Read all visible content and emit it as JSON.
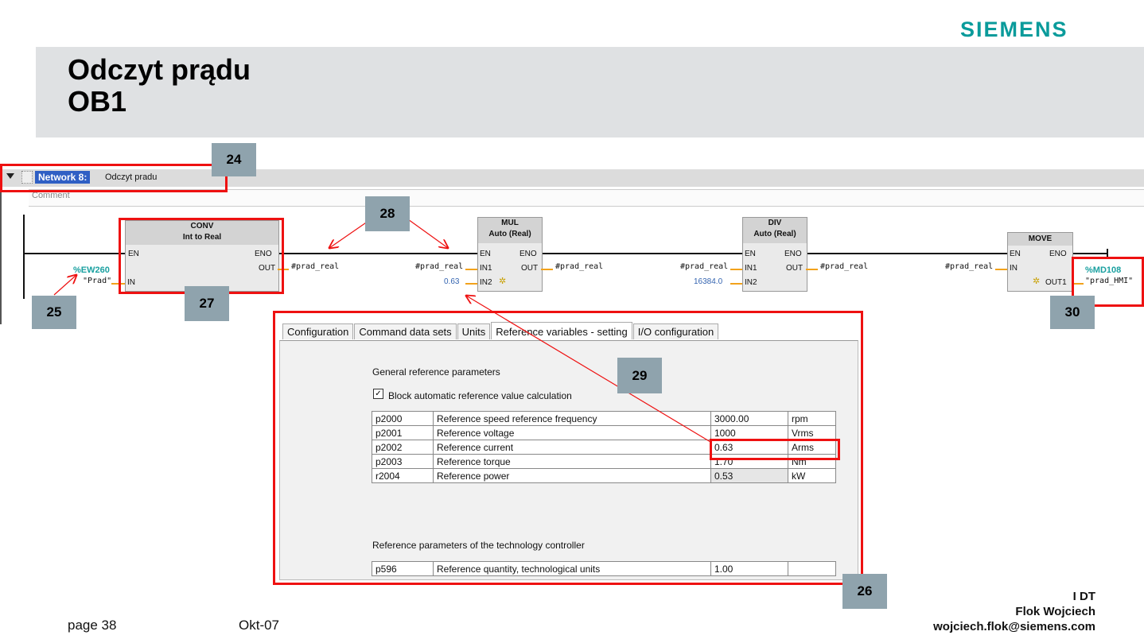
{
  "brand": {
    "logo": "SIEMENS",
    "color": "#0a9b9b"
  },
  "slide": {
    "title_line1": "Odczyt prądu",
    "title_line2": "OB1"
  },
  "network": {
    "label": "Network 8:",
    "title": "Odczyt pradu",
    "comment": "Comment"
  },
  "blocks": {
    "conv": {
      "name": "CONV",
      "type": "Int  to  Real",
      "en": "EN",
      "eno": "ENO",
      "out": "OUT",
      "in": "IN",
      "out_var": "#prad_real"
    },
    "input": {
      "address": "%EW260",
      "symbol": "\"Prad\""
    },
    "mul": {
      "name": "MUL",
      "type": "Auto (Real)",
      "en": "EN",
      "eno": "ENO",
      "in1": "IN1",
      "in2": "IN2",
      "out": "OUT",
      "in1_var": "#prad_real",
      "in2_val": "0.63",
      "out_var": "#prad_real"
    },
    "div": {
      "name": "DIV",
      "type": "Auto (Real)",
      "en": "EN",
      "eno": "ENO",
      "in1": "IN1",
      "in2": "IN2",
      "out": "OUT",
      "in1_var": "#prad_real",
      "in2_val": "16384.0",
      "out_var": "#prad_real"
    },
    "move": {
      "name": "MOVE",
      "en": "EN",
      "eno": "ENO",
      "in": "IN",
      "out1": "OUT1",
      "in_var": "#prad_real",
      "out_address": "%MD108",
      "out_symbol": "\"prad_HMI\""
    }
  },
  "dialog": {
    "tabs": [
      "Configuration",
      "Command data sets",
      "Units",
      "Reference variables - setting",
      "I/O configuration"
    ],
    "active_tab": "Reference variables - setting",
    "general_title": "General reference parameters",
    "checkbox_label": "Block automatic reference value calculation",
    "checkbox_checked": true,
    "params": [
      {
        "id": "p2000",
        "name": "Reference speed reference frequency",
        "value": "3000.00",
        "unit": "rpm"
      },
      {
        "id": "p2001",
        "name": "Reference voltage",
        "value": "1000",
        "unit": "Vrms"
      },
      {
        "id": "p2002",
        "name": "Reference current",
        "value": "0.63",
        "unit": "Arms"
      },
      {
        "id": "p2003",
        "name": "Reference torque",
        "value": "1.70",
        "unit": "Nm"
      },
      {
        "id": "r2004",
        "name": "Reference power",
        "value": "0.53",
        "unit": "kW"
      }
    ],
    "tech_title": "Reference parameters of the technology controller",
    "tech_params": [
      {
        "id": "p596",
        "name": "Reference quantity, technological units",
        "value": "1.00",
        "unit": ""
      }
    ]
  },
  "callouts": {
    "c24": "24",
    "c25": "25",
    "c26": "26",
    "c27": "27",
    "c28": "28",
    "c29": "29",
    "c30": "30"
  },
  "footer": {
    "page": "page 38",
    "date": "Okt-07",
    "dept": "I DT",
    "author": "Flok Wojciech",
    "email": "wojciech.flok@siemens.com"
  }
}
